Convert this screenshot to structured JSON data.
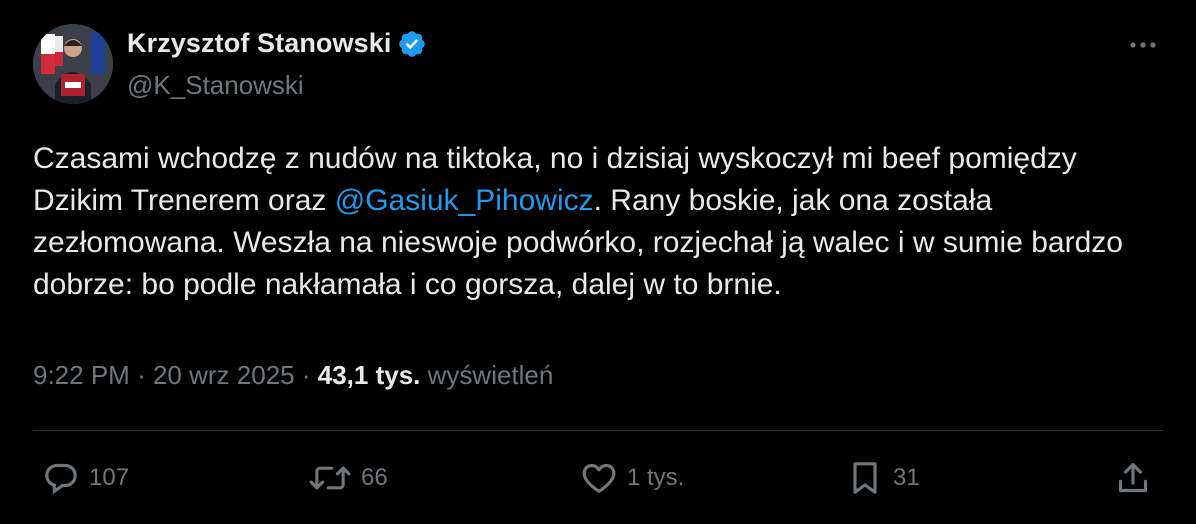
{
  "tweet": {
    "author": {
      "display_name": "Krzysztof Stanowski",
      "handle": "@K_Stanowski",
      "verified_icon": "verified-badge-icon",
      "verified_color": "#1d9bf0"
    },
    "text_parts": {
      "part1": "Czasami wchodzę z nudów na tiktoka, no i dzisiaj wyskoczył mi beef pomiędzy Dzikim Trenerem oraz ",
      "mention": "@Gasiuk_Pihowicz",
      "part2": ". Rany boskie, jak ona została zezłomowana. Weszła na nieswoje podwórko, rozjechał ją walec i w sumie bardzo dobrze: bo podle nakłamała i co gorsza, dalej w to brnie."
    },
    "meta": {
      "time": "9:22 PM",
      "separator": "·",
      "date": "20 wrz 2025",
      "views_count": "43,1 tys.",
      "views_label": "wyświetleń"
    },
    "actions": {
      "replies": "107",
      "reposts": "66",
      "likes": "1 tys.",
      "bookmarks": "31"
    }
  },
  "colors": {
    "background": "#000000",
    "text_primary": "#e7e9ea",
    "text_secondary": "#71767b",
    "accent": "#1d9bf0",
    "divider": "#2f3336"
  }
}
